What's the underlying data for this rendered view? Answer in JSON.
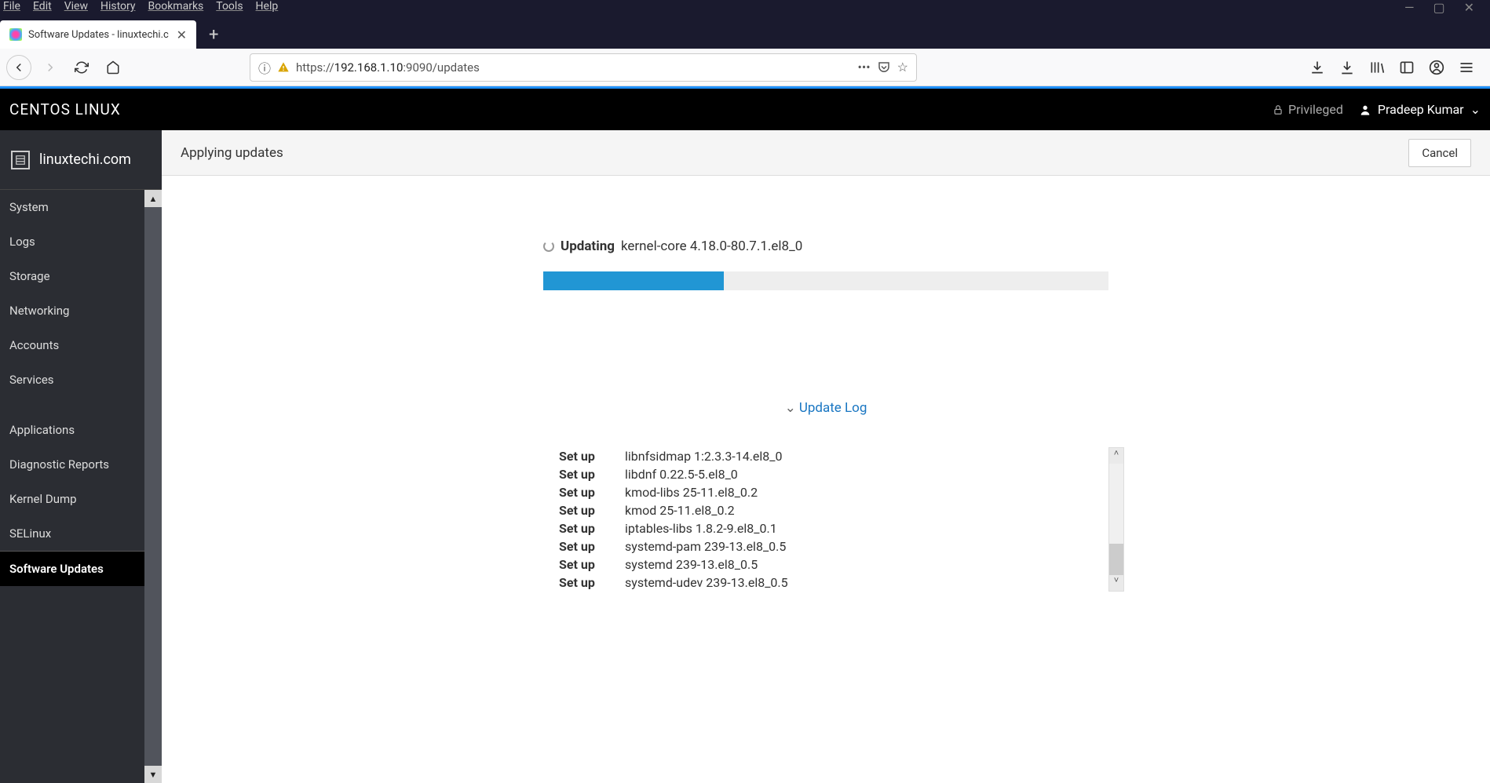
{
  "menubar": [
    "File",
    "Edit",
    "View",
    "History",
    "Bookmarks",
    "Tools",
    "Help"
  ],
  "tab": {
    "title": "Software Updates - linuxtechi.c"
  },
  "url": {
    "scheme": "https://",
    "host": "192.168.1.10",
    "port_path": ":9090/updates"
  },
  "cockpit": {
    "brand": "CENTOS LINUX",
    "privileged": "Privileged",
    "user": "Pradeep Kumar"
  },
  "host": "linuxtechi.com",
  "sidebar": {
    "items": [
      "System",
      "Logs",
      "Storage",
      "Networking",
      "Accounts",
      "Services",
      "Applications",
      "Diagnostic Reports",
      "Kernel Dump",
      "SELinux",
      "Software Updates"
    ],
    "active_index": 10
  },
  "page": {
    "title": "Applying updates",
    "cancel": "Cancel",
    "updating_label": "Updating",
    "updating_package": "kernel-core 4.18.0-80.7.1.el8_0",
    "progress_percent": 32,
    "loglink": "Update Log",
    "log": [
      {
        "action": "Set up",
        "pkg": "libnfsidmap 1:2.3.3-14.el8_0"
      },
      {
        "action": "Set up",
        "pkg": "libdnf 0.22.5-5.el8_0"
      },
      {
        "action": "Set up",
        "pkg": "kmod-libs 25-11.el8_0.2"
      },
      {
        "action": "Set up",
        "pkg": "kmod 25-11.el8_0.2"
      },
      {
        "action": "Set up",
        "pkg": "iptables-libs 1.8.2-9.el8_0.1"
      },
      {
        "action": "Set up",
        "pkg": "systemd-pam 239-13.el8_0.5"
      },
      {
        "action": "Set up",
        "pkg": "systemd 239-13.el8_0.5"
      },
      {
        "action": "Set up",
        "pkg": "systemd-udev 239-13.el8_0.5"
      }
    ]
  }
}
